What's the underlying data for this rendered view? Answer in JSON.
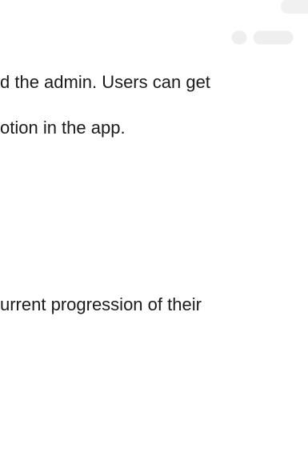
{
  "paragraph_1": {
    "line_1": "d the admin. Users can get",
    "line_2": "otion in the app."
  },
  "paragraph_2": {
    "line_1": "urrent progression of their"
  },
  "background": {
    "icon": "smartphone-outline-icon",
    "stroke_color": "#f1f1f1"
  }
}
